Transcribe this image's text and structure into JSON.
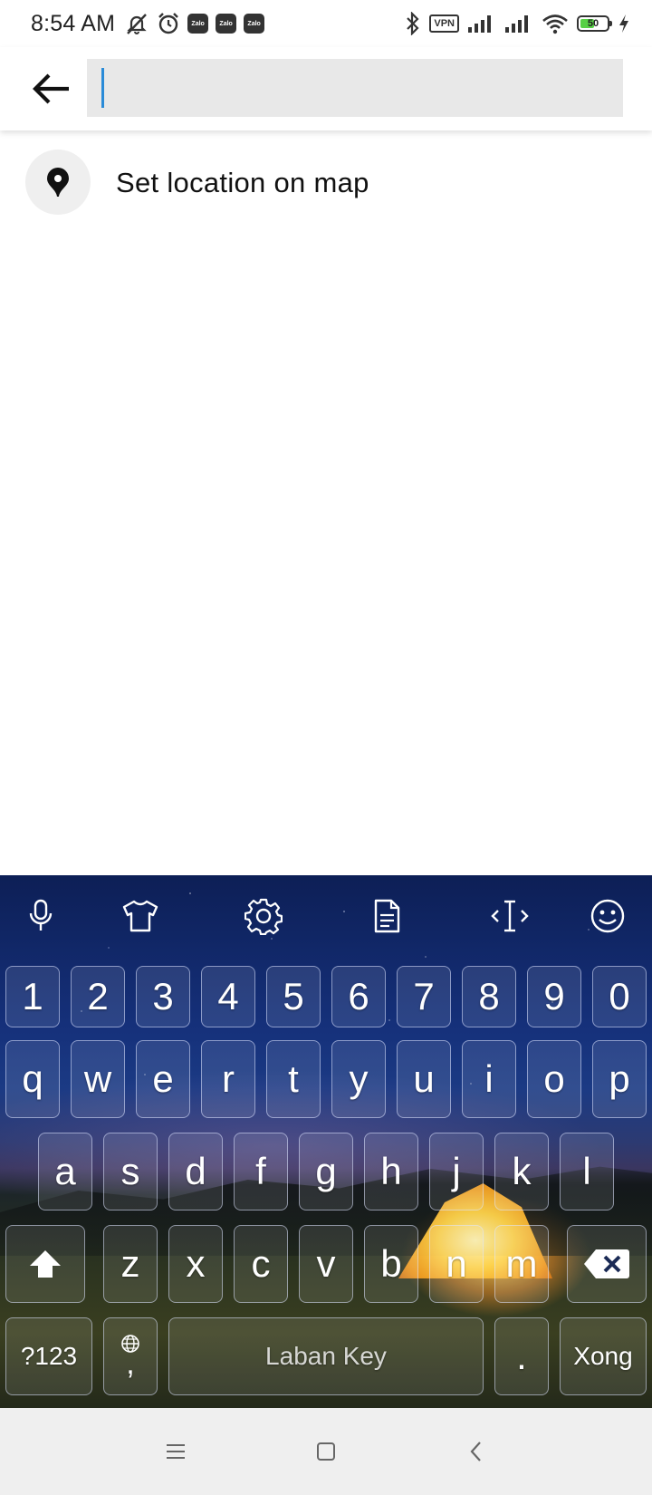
{
  "status_bar": {
    "time": "8:54 AM",
    "notification_icons": [
      "muted-bell-icon",
      "alarm-icon",
      "zalo-icon",
      "zalo-icon",
      "zalo-icon"
    ],
    "zalo_label": "Zalo",
    "vpn_label": "VPN",
    "battery_level": "50",
    "battery_color": "#57d044"
  },
  "header": {
    "search_value": "",
    "search_placeholder": "",
    "caret_color": "#2a8bd8"
  },
  "location_item": {
    "label": "Set location on map",
    "icon": "map-pin-icon"
  },
  "keyboard": {
    "toolbar_icons": [
      "microphone-icon",
      "theme-shirt-icon",
      "settings-gear-icon",
      "clipboard-icon",
      "cursor-move-icon",
      "emoji-icon"
    ],
    "number_row": [
      "1",
      "2",
      "3",
      "4",
      "5",
      "6",
      "7",
      "8",
      "9",
      "0"
    ],
    "row1": [
      "q",
      "w",
      "e",
      "r",
      "t",
      "y",
      "u",
      "i",
      "o",
      "p"
    ],
    "row2": [
      "a",
      "s",
      "d",
      "f",
      "g",
      "h",
      "j",
      "k",
      "l"
    ],
    "row3": [
      "z",
      "x",
      "c",
      "v",
      "b",
      "n",
      "m"
    ],
    "symbols_label": "?123",
    "comma_label": ",",
    "space_label": "Laban Key",
    "period_label": ".",
    "done_label": "Xong"
  },
  "nav_bar": {
    "icons": [
      "recents-menu-icon",
      "home-square-icon",
      "back-chevron-icon"
    ]
  }
}
